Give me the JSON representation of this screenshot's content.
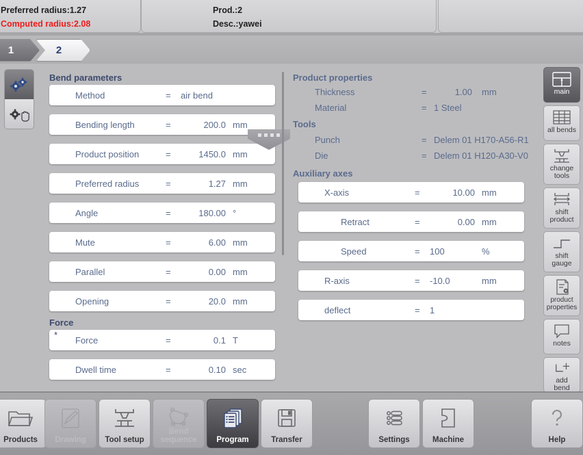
{
  "header": {
    "left": {
      "line1": "Preferred radius:1.27",
      "line2": "Computed radius:2.08"
    },
    "middle": {
      "line1": "Prod.:2",
      "line2": "Desc.:yawei"
    }
  },
  "breadcrumbs": [
    {
      "label": "1",
      "active": false
    },
    {
      "label": "2",
      "active": true
    }
  ],
  "mode_strip": {
    "auto_icon": "gears-icon",
    "manual_icon": "gear-hand-icon"
  },
  "left_panel": {
    "sections": [
      {
        "title": "Bend parameters",
        "rows": [
          {
            "label": "Method",
            "eq": "=",
            "value": "air bend",
            "unit": "",
            "align": "left"
          },
          {
            "label": "Bending length",
            "eq": "=",
            "value": "200.0",
            "unit": "mm",
            "align": "right"
          },
          {
            "label": "Product position",
            "eq": "=",
            "value": "1450.0",
            "unit": "mm",
            "align": "right"
          },
          {
            "label": "Preferred radius",
            "eq": "=",
            "value": "1.27",
            "unit": "mm",
            "align": "right"
          },
          {
            "label": "Angle",
            "eq": "=",
            "value": "180.00",
            "unit": "°",
            "align": "right"
          },
          {
            "label": "Mute",
            "eq": "=",
            "value": "6.00",
            "unit": "mm",
            "align": "right"
          },
          {
            "label": "Parallel",
            "eq": "=",
            "value": "0.00",
            "unit": "mm",
            "align": "right"
          },
          {
            "label": "Opening",
            "eq": "=",
            "value": "20.0",
            "unit": "mm",
            "align": "right"
          }
        ]
      },
      {
        "title": "Force",
        "rows": [
          {
            "label": "Force",
            "eq": "=",
            "value": "0.1",
            "unit": "T",
            "align": "right",
            "marker": "*"
          },
          {
            "label": "Dwell time",
            "eq": "=",
            "value": "0.10",
            "unit": "sec",
            "align": "right"
          }
        ]
      }
    ]
  },
  "right_panel": {
    "product_properties": {
      "title": "Product properties",
      "rows": [
        {
          "label": "Thickness",
          "eq": "=",
          "value": "1.00",
          "unit": "mm",
          "align": "right"
        },
        {
          "label": "Material",
          "eq": "=",
          "value": "1 Steel",
          "unit": "",
          "align": "left"
        }
      ]
    },
    "tools": {
      "title": "Tools",
      "rows": [
        {
          "label": "Punch",
          "eq": "=",
          "value": "Delem 01 H170-A56-R1",
          "unit": "",
          "align": "left"
        },
        {
          "label": "Die",
          "eq": "=",
          "value": "Delem 01 H120-A30-V0",
          "unit": "",
          "align": "left"
        }
      ]
    },
    "auxiliary_axes": {
      "title": "Auxiliary axes",
      "rows": [
        {
          "label": "X-axis",
          "eq": "=",
          "value": "10.00",
          "unit": "mm",
          "indent": false
        },
        {
          "label": "Retract",
          "eq": "=",
          "value": "0.00",
          "unit": "mm",
          "indent": true
        },
        {
          "label": "Speed",
          "eq": "=",
          "value": "100",
          "unit": "%",
          "indent": true
        },
        {
          "label": "R-axis",
          "eq": "=",
          "value": "-10.0",
          "unit": "mm",
          "indent": false
        },
        {
          "label": "deflect",
          "eq": "=",
          "value": "1",
          "unit": "",
          "indent": false
        }
      ]
    }
  },
  "sidebar": {
    "items": [
      {
        "label": "main",
        "icon": "window-layout-icon",
        "active": true
      },
      {
        "label": "all bends",
        "icon": "table-grid-icon",
        "active": false
      },
      {
        "label": "change\ntools",
        "icon": "press-tools-icon",
        "active": false
      },
      {
        "label": "shift\nproduct",
        "icon": "shift-product-icon",
        "active": false
      },
      {
        "label": "shift\ngauge",
        "icon": "shift-gauge-icon",
        "active": false
      },
      {
        "label": "product\nproperties",
        "icon": "document-gear-icon",
        "active": false
      },
      {
        "label": "notes",
        "icon": "speech-bubble-icon",
        "active": false
      },
      {
        "label": "add\nbend",
        "icon": "add-bend-icon",
        "active": false
      }
    ]
  },
  "toolbar": {
    "items": [
      {
        "label": "Products",
        "icon": "folder-icon",
        "state": "normal"
      },
      {
        "label": "Drawing",
        "icon": "pencil-page-icon",
        "state": "disabled"
      },
      {
        "label": "Tool setup",
        "icon": "press-brake-icon",
        "state": "normal"
      },
      {
        "label": "Bend\nsequence",
        "icon": "polygon-nodes-icon",
        "state": "disabled"
      },
      {
        "label": "Program",
        "icon": "stacked-pages-icon",
        "state": "active"
      },
      {
        "label": "Transfer",
        "icon": "floppy-disk-icon",
        "state": "normal"
      },
      {
        "label": "Settings",
        "icon": "sliders-icon",
        "state": "normal"
      },
      {
        "label": "Machine",
        "icon": "machine-icon",
        "state": "normal"
      },
      {
        "label": "Help",
        "icon": "question-mark-icon",
        "state": "normal"
      }
    ]
  },
  "colors": {
    "accent_blue": "#3c4a6b",
    "value_text": "#5a6b8c",
    "alert_red": "#ee1c1c",
    "panel_bg": "#bcbcbf"
  }
}
